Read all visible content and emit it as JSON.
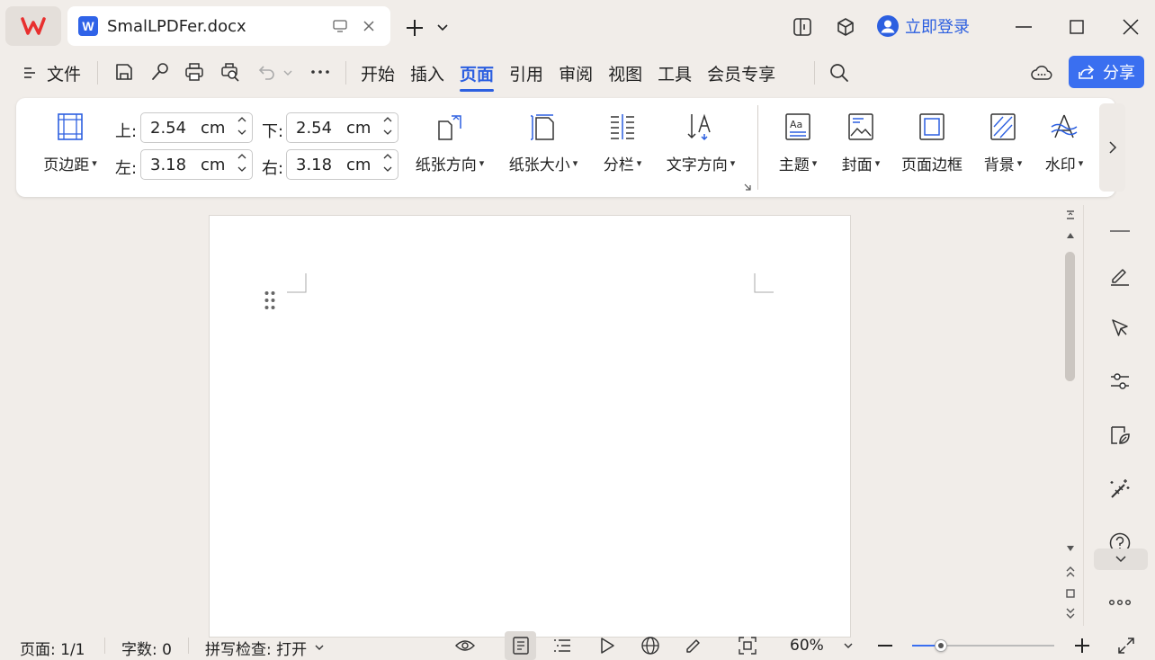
{
  "titlebar": {
    "doc_title": "SmalLPDFer.docx",
    "login_label": "立即登录"
  },
  "menubar": {
    "file_label": "文件",
    "tabs": [
      {
        "label": "开始"
      },
      {
        "label": "插入"
      },
      {
        "label": "页面",
        "active": true
      },
      {
        "label": "引用"
      },
      {
        "label": "审阅"
      },
      {
        "label": "视图"
      },
      {
        "label": "工具"
      },
      {
        "label": "会员专享"
      }
    ],
    "share_label": "分享"
  },
  "ribbon": {
    "margins_label": "页边距",
    "top_label": "上:",
    "bottom_label": "下:",
    "left_label": "左:",
    "right_label": "右:",
    "top_value": "2.54",
    "bottom_value": "2.54",
    "left_value": "3.18",
    "right_value": "3.18",
    "unit": "cm",
    "orientation_label": "纸张方向",
    "size_label": "纸张大小",
    "columns_label": "分栏",
    "text_direction_label": "文字方向",
    "theme_label": "主题",
    "cover_label": "封面",
    "page_border_label": "页面边框",
    "background_label": "背景",
    "watermark_label": "水印"
  },
  "status": {
    "page_info": "页面: 1/1",
    "word_count": "字数: 0",
    "spell_check": "拼写检查: 打开",
    "zoom": "60%",
    "zoom_fraction": 0.2
  },
  "colors": {
    "accent": "#2c5fe0",
    "wps_red": "#e8302f",
    "background": "#f1ede9"
  }
}
